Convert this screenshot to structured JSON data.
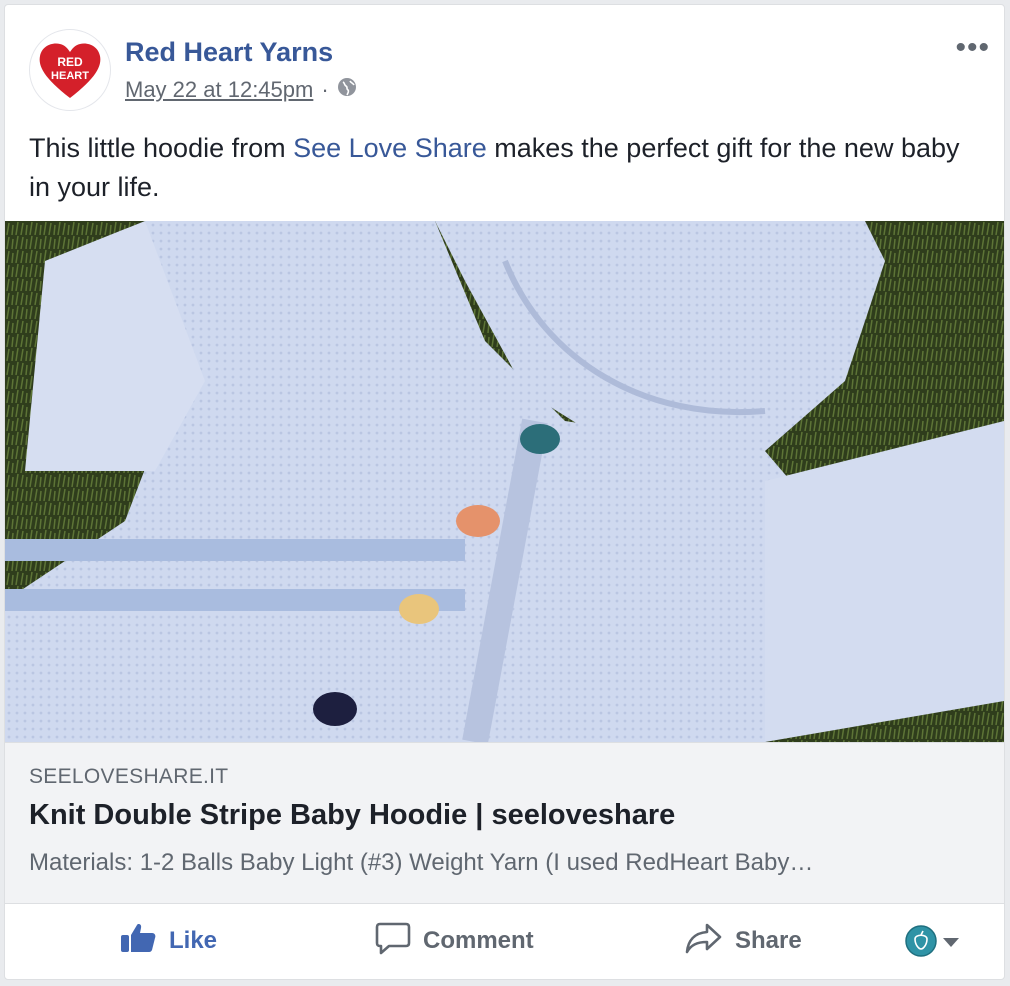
{
  "post": {
    "page_name": "Red Heart Yarns",
    "timestamp": "May 22 at 12:45pm",
    "separator": "·",
    "audience_icon": "globe-icon",
    "more_label": "•••",
    "text_before": "This little hoodie from ",
    "text_link": "See Love Share",
    "text_after": " makes the perfect gift for the new baby in your life.",
    "logo": {
      "line1": "RED",
      "line2": "HEART",
      "color": "#d4202a"
    }
  },
  "link_preview": {
    "domain": "SEELOVESHARE.IT",
    "title": "Knit Double Stripe Baby Hoodie | seeloveshare",
    "description": "Materials: 1-2 Balls Baby Light (#3) Weight Yarn (I used RedHeart Baby…"
  },
  "actions": {
    "like": "Like",
    "comment": "Comment",
    "share": "Share",
    "like_color": "#4267b2",
    "reactor_icon": "profile-avatar-icon",
    "dropdown_icon": "caret-down-icon"
  }
}
